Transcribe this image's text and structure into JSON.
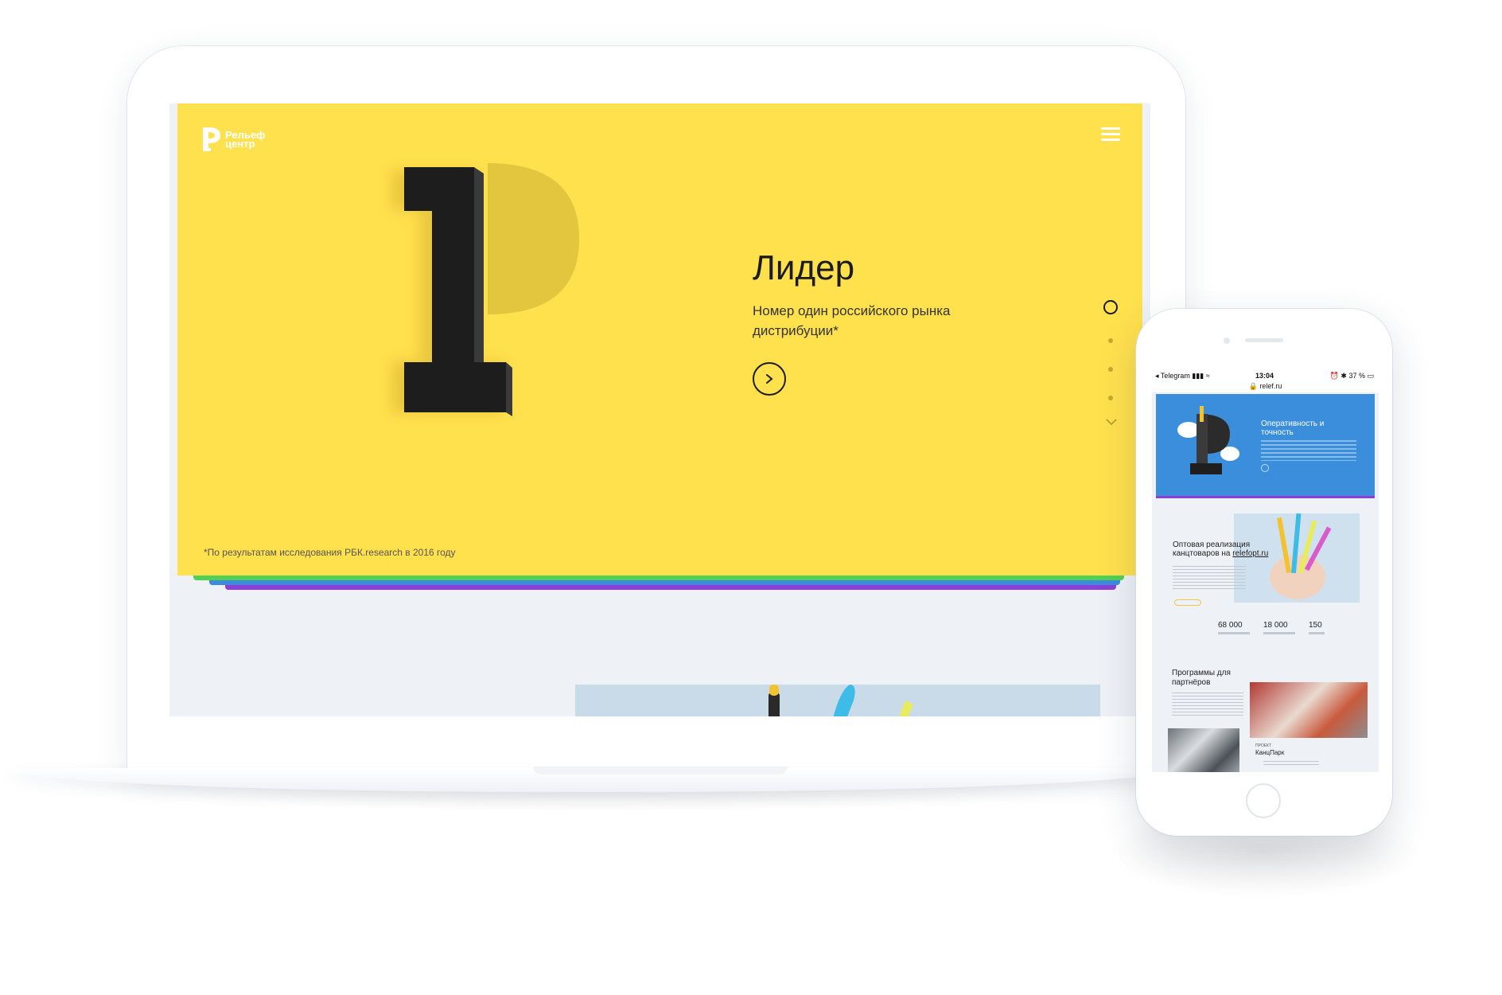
{
  "colors": {
    "hero_yellow": "#ffe04d",
    "accent_green": "#52d053",
    "accent_blue": "#3d8be0",
    "accent_purple": "#8e3fd6",
    "text_dark": "#1b1b1b"
  },
  "desktop": {
    "logo": {
      "line1": "Рельеф",
      "line2": "центр"
    },
    "menu_icon": "hamburger-icon",
    "hero": {
      "title": "Лидер",
      "subtitle": "Номер один российского рынка дистрибуции*",
      "button_icon": "chevron-right-icon",
      "footnote": "*По результатам исследования РБК.research в 2016 году"
    },
    "pager": {
      "active_index": 0,
      "count": 4,
      "down_icon": "chevron-down-icon"
    }
  },
  "mobile": {
    "status": {
      "back_app": "Telegram",
      "time": "13:04",
      "battery": "37 %"
    },
    "url": "relef.ru",
    "hero_title": "Оперативность и точность",
    "card": {
      "title_prefix": "Оптовая реализация канцтоваров на ",
      "title_link": "relefopt.ru"
    },
    "stats": [
      {
        "value": "68 000"
      },
      {
        "value": "18 000"
      },
      {
        "value": "150"
      }
    ],
    "programs_title": "Программы для партнёров",
    "project": {
      "caption": "ПРОЕКТ",
      "name": "КанцПарк"
    }
  }
}
